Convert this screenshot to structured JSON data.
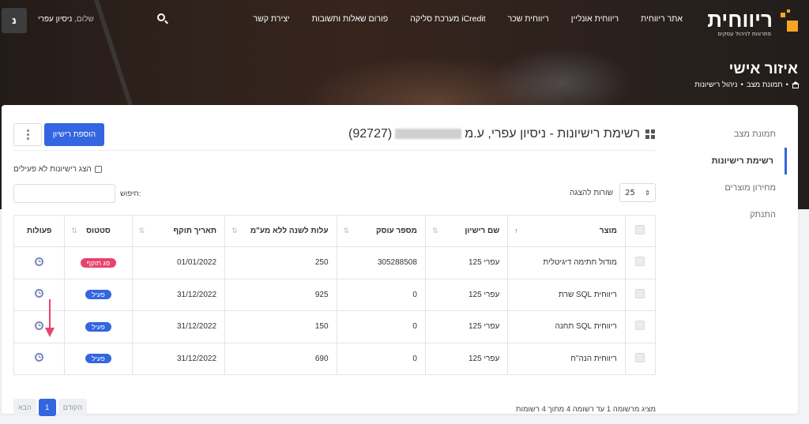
{
  "brand": {
    "name": "ריווחית",
    "tagline": "פתרונות לניהול עסקים",
    "accent": "#f5a623"
  },
  "nav": {
    "links": [
      "אתר ריווחית",
      "ריווחית אונליין",
      "ריווחית שכר",
      "מערכת סליקה iCredit",
      "פורום שאלות ותשובות",
      "יצירת קשר"
    ]
  },
  "user": {
    "greeting": "שלום,",
    "name": "ניסיון עפרי",
    "initial": "נ"
  },
  "page": {
    "title": "איזור אישי",
    "breadcrumb": [
      "תמונת מצב",
      "ניהול רישיונות"
    ]
  },
  "side_menu": {
    "items": [
      "תמונת מצב",
      "רשימת רישיונות",
      "מחירון מוצרים",
      "התנתק"
    ],
    "active_index": 1
  },
  "content": {
    "title_prefix": "רשימת רישיונות - ניסיון עפרי, ע.מ",
    "title_suffix": "(92727)",
    "add_button": "הוספת רישיון",
    "show_inactive_label": "הצג רישיונות לא פעילים",
    "search_label": "חיפוש:",
    "rows_label": "שורות להצגה",
    "rows_value": "25"
  },
  "table": {
    "headers": [
      "מוצר",
      "שם רישיון",
      "מספר עוסק",
      "עלות לשנה ללא מע\"מ",
      "תאריך תוקף",
      "סטטוס",
      "פעולות"
    ],
    "rows": [
      {
        "product": "מודול חתימה דיגיטלית",
        "license": "עפרי 125",
        "biz": "305288508",
        "cost": "250",
        "expiry": "01/01/2022",
        "status": "פג תוקף",
        "status_type": "expired"
      },
      {
        "product": "ריווחית SQL שרת",
        "license": "עפרי 125",
        "biz": "0",
        "cost": "925",
        "expiry": "31/12/2022",
        "status": "פעיל",
        "status_type": "active"
      },
      {
        "product": "ריווחית SQL תחנה",
        "license": "עפרי 125",
        "biz": "0",
        "cost": "150",
        "expiry": "31/12/2022",
        "status": "פעיל",
        "status_type": "active"
      },
      {
        "product": "ריווחית הנה\"ח",
        "license": "עפרי 125",
        "biz": "0",
        "cost": "690",
        "expiry": "31/12/2022",
        "status": "פעיל",
        "status_type": "active"
      }
    ]
  },
  "footer": {
    "info": "מציג מרשומה 1 עד רשומה 4 מתוך 4 רשומות",
    "prev": "הקודם",
    "page": "1",
    "next": "הבא"
  },
  "colors": {
    "primary": "#3366e0",
    "expired": "#e8436e",
    "active": "#3366e0"
  }
}
